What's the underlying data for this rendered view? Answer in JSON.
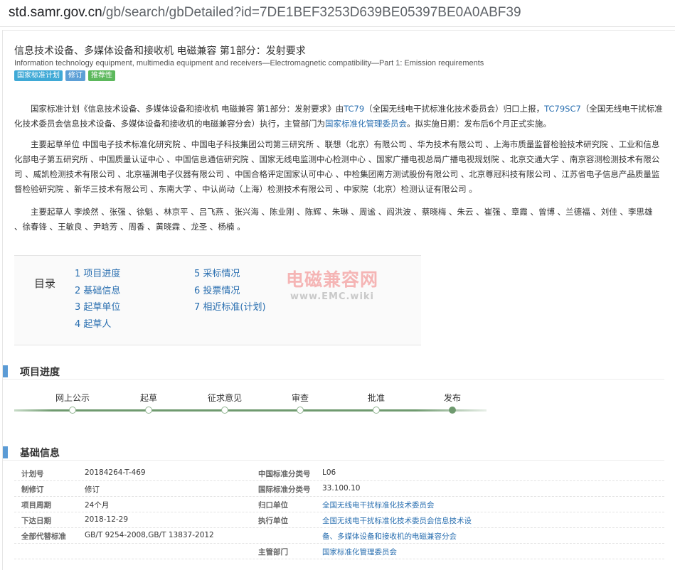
{
  "browser": {
    "url_host": "std.samr.gov.cn",
    "url_path": "/gb/search/gbDetailed?id=7DE1BEF3253D639BE05397BE0A0ABF39"
  },
  "header": {
    "title_cn": "信息技术设备、多媒体设备和接收机 电磁兼容 第1部分：发射要求",
    "title_en": "Information technology equipment, multimedia equipment and receivers—Electromagnetic compatibility—Part 1: Emission requirements",
    "badges": [
      "国家标准计划",
      "修订",
      "推荐性"
    ]
  },
  "intro": {
    "p1a": "国家标准计划《信息技术设备、多媒体设备和接收机 电磁兼容 第1部分：发射要求》由",
    "tc1": "TC79",
    "p1b": "（全国无线电干扰标准化技术委员会）归口上报，",
    "tc2": "TC79SC7",
    "p1c": "（全国无线电干扰标准化技术委员会信息技术设备、多媒体设备和接收机的电磁兼容分会）执行，主管部门为",
    "dept": "国家标准化管理委员会",
    "p1d": "。拟实施日期：发布后6个月正式实施。",
    "p2": "主要起草单位 中国电子技术标准化研究院 、中国电子科技集团公司第三研究所 、联想（北京）有限公司 、华为技术有限公司 、上海市质量监督检验技术研究院 、工业和信息化部电子第五研究所 、中国质量认证中心 、中国信息通信研究院 、国家无线电监测中心检测中心 、国家广播电视总局广播电视规划院 、北京交通大学 、南京容测检测技术有限公司 、威凯检测技术有限公司 、北京福渊电子仪器有限公司 、中国合格评定国家认可中心 、中检集团南方测试股份有限公司 、北京尊冠科技有限公司 、江苏省电子信息产品质量监督检验研究院 、新华三技术有限公司 、东南大学 、中认尚动（上海）检测技术有限公司 、中家院（北京）检测认证有限公司 。",
    "p3": "主要起草人 李焕然 、张强 、徐魁 、林京平 、吕飞燕 、张兴海 、陈业刚 、陈辉 、朱琳 、周谧 、阎洪波 、蔡晓梅 、朱云 、崔强 、章霞 、曾博 、兰德福 、刘佳 、李思雄 、徐春锋 、王敏良 、尹晗芳 、周香 、黄晓霖 、龙圣 、杨楠 。"
  },
  "toc": {
    "label": "目录",
    "col1": [
      "1 项目进度",
      "2 基础信息",
      "3 起草单位",
      "4 起草人"
    ],
    "col2": [
      "5 采标情况",
      "6 投票情况",
      "7 相近标准(计划)"
    ],
    "watermark_cn": "电磁兼容网",
    "watermark_en": "www.EMC.wiki"
  },
  "progress": {
    "section_title": "项目进度",
    "steps": [
      "网上公示",
      "起草",
      "征求意见",
      "审查",
      "批准",
      "发布"
    ],
    "current_index": 5
  },
  "basic": {
    "section_title": "基础信息",
    "rows": [
      {
        "k1": "计划号",
        "v1": "20184264-T-469",
        "k2": "中国标准分类号",
        "v2": "L06"
      },
      {
        "k1": "制修订",
        "v1": "修订",
        "k2": "国际标准分类号",
        "v2": "33.100.10"
      },
      {
        "k1": "项目周期",
        "v1": "24个月",
        "k2": "归口单位",
        "v2": "全国无线电干扰标准化技术委员会"
      },
      {
        "k1": "下达日期",
        "v1": "2018-12-29",
        "k2": "执行单位",
        "v2": "全国无线电干扰标准化技术委员会信息技术设"
      },
      {
        "k1": "全部代替标准",
        "v1": "GB/T 9254-2008,GB/T 13837-2012",
        "k2": "",
        "v2": "备、多媒体设备和接收机的电磁兼容分会"
      },
      {
        "k1": "",
        "v1": "",
        "k2": "主管部门",
        "v2": "国家标准化管理委员会"
      }
    ]
  },
  "colors": {
    "link": "#2a6fb0",
    "accent": "#5b9bd5",
    "progress": "#6f9a6f"
  }
}
